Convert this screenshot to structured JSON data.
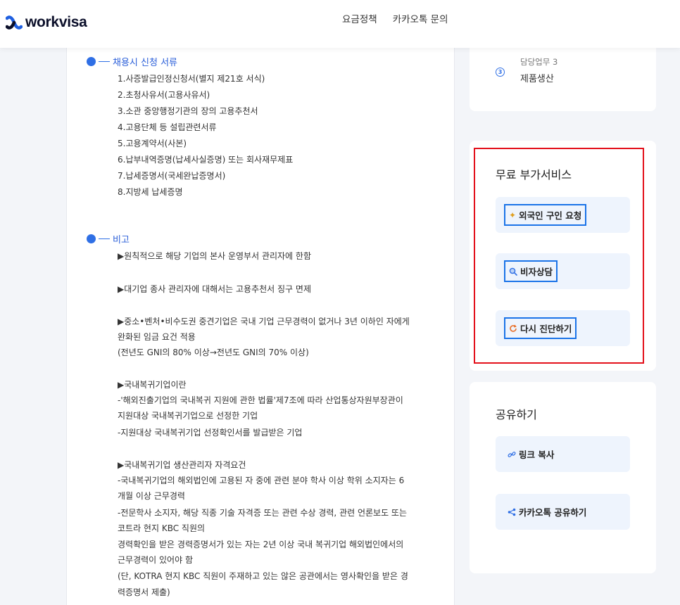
{
  "brand": {
    "name": "workvisa"
  },
  "nav": {
    "pricing": "요금정책",
    "kakao_inquiry": "카카오톡 문의"
  },
  "documents": {
    "title": "채용시 신청 서류",
    "items": [
      "1.사증발급인정신청서(별지 제21호 서식)",
      "2.초청사유서(고용사유서)",
      "3.소관 중앙행정기관의 장의 고용추천서",
      "4.고용단체 등 설립관련서류",
      "5.고용계약서(사본)",
      "6.납부내역증명(납세사실증명) 또는 회사재무제표",
      "7.납세증명서(국세완납증명서)",
      "8.지방세 납세증명"
    ]
  },
  "remarks": {
    "title": "비고",
    "lines": [
      "▶원칙적으로 해당 기업의 본사 운영부서 관리자에 한함",
      "▶대기업 종사 관리자에 대해서는 고용추천서 징구 면제",
      "▶중소•벤처•비수도권 중견기업은 국내 기업 근무경력이 없거나 3년 이하인 자에게",
      "완화된 임금 요건 적용",
      "(전년도 GNI의 80% 이상→전년도 GNI의 70% 이상)",
      "▶국내복귀기업이란",
      "-'해외진출기업의 국내복귀 지원에 관한 법률'제7조에 따라 산업통상자원부장관이",
      "지원대상 국내복귀기업으로 선정한 기업",
      "-지원대상 국내복귀기업 선정확인서를 발급받은 기업",
      "▶국내복귀기업 생산관리자 자격요건",
      "-국내복귀기업의 해외법인에 고용된 자 중에 관련 분야 학사 이상 학위 소지자는 6",
      "개월 이상 근무경력",
      "-전문학사 소지자, 해당 직종 기술 자격증 또는 관련 수상 경력, 관련 언론보도 또는",
      "코트라 현지 KBC 직원의",
      "경력확인을 받은 경력증명서가 있는 자는 2년 이상 국내 복귀기업 해외법인에서의",
      "근무경력이 있어야 함",
      "(단, KOTRA 현지 KBC 직원이 주재하고 있는 않은 공관에서는 영사확인을 받은 경",
      "력증명서 제출)"
    ]
  },
  "duty": {
    "label": "담당업무 3",
    "number": "3",
    "value": "제품생산"
  },
  "free_services": {
    "title": "무료 부가서비스",
    "buttons": [
      {
        "label": "외국인 구인 요청",
        "icon": "✦"
      },
      {
        "label": "비자상담",
        "icon": "🔍"
      },
      {
        "label": "다시 진단하기",
        "icon": "↻"
      }
    ]
  },
  "share": {
    "title": "공유하기",
    "buttons": [
      {
        "label": "링크 복사"
      },
      {
        "label": "카카오톡 공유하기"
      }
    ]
  },
  "colors": {
    "accent": "#2f6fe5",
    "highlight": "#1a73e8",
    "annotation": "#e3101b"
  }
}
